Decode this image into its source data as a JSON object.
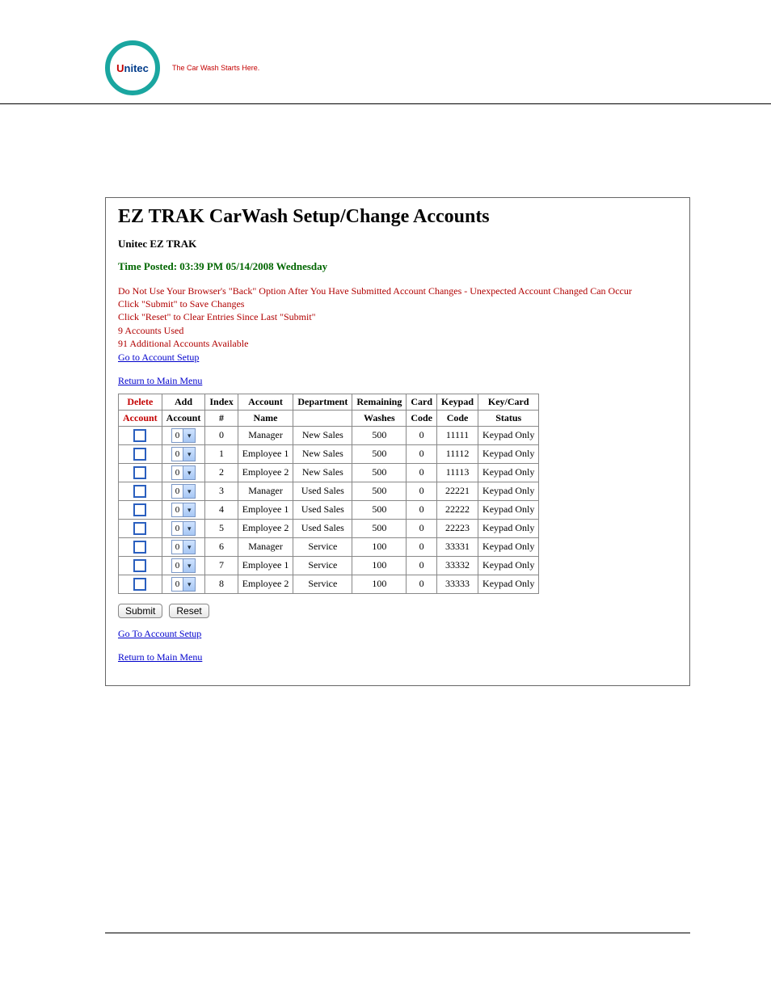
{
  "logo": {
    "brand_prefix": "U",
    "brand_rest": "nitec",
    "tagline": "The Car Wash Starts Here."
  },
  "page": {
    "title": "EZ TRAK CarWash Setup/Change Accounts",
    "subtitle": "Unitec EZ TRAK",
    "time_posted": "Time Posted: 03:39 PM 05/14/2008 Wednesday"
  },
  "info": {
    "warn": "Do Not Use Your Browser's \"Back\" Option After You Have Submitted Account Changes - Unexpected Account Changed Can Occur",
    "submit_hint": "Click \"Submit\" to Save Changes",
    "reset_hint": "Click \"Reset\" to Clear Entries Since Last \"Submit\"",
    "used": "9 Accounts Used",
    "avail": "91 Additional Accounts Available"
  },
  "links": {
    "goto_setup": "Go to Account Setup",
    "goto_setup2": "Go To Account Setup",
    "return_main": "Return to Main Menu"
  },
  "buttons": {
    "submit": "Submit",
    "reset": "Reset"
  },
  "table": {
    "headers": {
      "r1": [
        "Delete",
        "Add",
        "Index",
        "Account",
        "Department",
        "Remaining",
        "Card",
        "Keypad",
        "Key/Card"
      ],
      "r2": [
        "Account",
        "Account",
        "#",
        "Name",
        "",
        "Washes",
        "Code",
        "Code",
        "Status"
      ]
    },
    "rows": [
      {
        "add": "0",
        "index": "0",
        "name": "Manager",
        "dept": "New Sales",
        "washes": "500",
        "card": "0",
        "keypad": "11111",
        "status": "Keypad Only"
      },
      {
        "add": "0",
        "index": "1",
        "name": "Employee 1",
        "dept": "New Sales",
        "washes": "500",
        "card": "0",
        "keypad": "11112",
        "status": "Keypad Only"
      },
      {
        "add": "0",
        "index": "2",
        "name": "Employee 2",
        "dept": "New Sales",
        "washes": "500",
        "card": "0",
        "keypad": "11113",
        "status": "Keypad Only"
      },
      {
        "add": "0",
        "index": "3",
        "name": "Manager",
        "dept": "Used Sales",
        "washes": "500",
        "card": "0",
        "keypad": "22221",
        "status": "Keypad Only"
      },
      {
        "add": "0",
        "index": "4",
        "name": "Employee 1",
        "dept": "Used Sales",
        "washes": "500",
        "card": "0",
        "keypad": "22222",
        "status": "Keypad Only"
      },
      {
        "add": "0",
        "index": "5",
        "name": "Employee 2",
        "dept": "Used Sales",
        "washes": "500",
        "card": "0",
        "keypad": "22223",
        "status": "Keypad Only"
      },
      {
        "add": "0",
        "index": "6",
        "name": "Manager",
        "dept": "Service",
        "washes": "100",
        "card": "0",
        "keypad": "33331",
        "status": "Keypad Only"
      },
      {
        "add": "0",
        "index": "7",
        "name": "Employee 1",
        "dept": "Service",
        "washes": "100",
        "card": "0",
        "keypad": "33332",
        "status": "Keypad Only"
      },
      {
        "add": "0",
        "index": "8",
        "name": "Employee 2",
        "dept": "Service",
        "washes": "100",
        "card": "0",
        "keypad": "33333",
        "status": "Keypad Only"
      }
    ]
  }
}
